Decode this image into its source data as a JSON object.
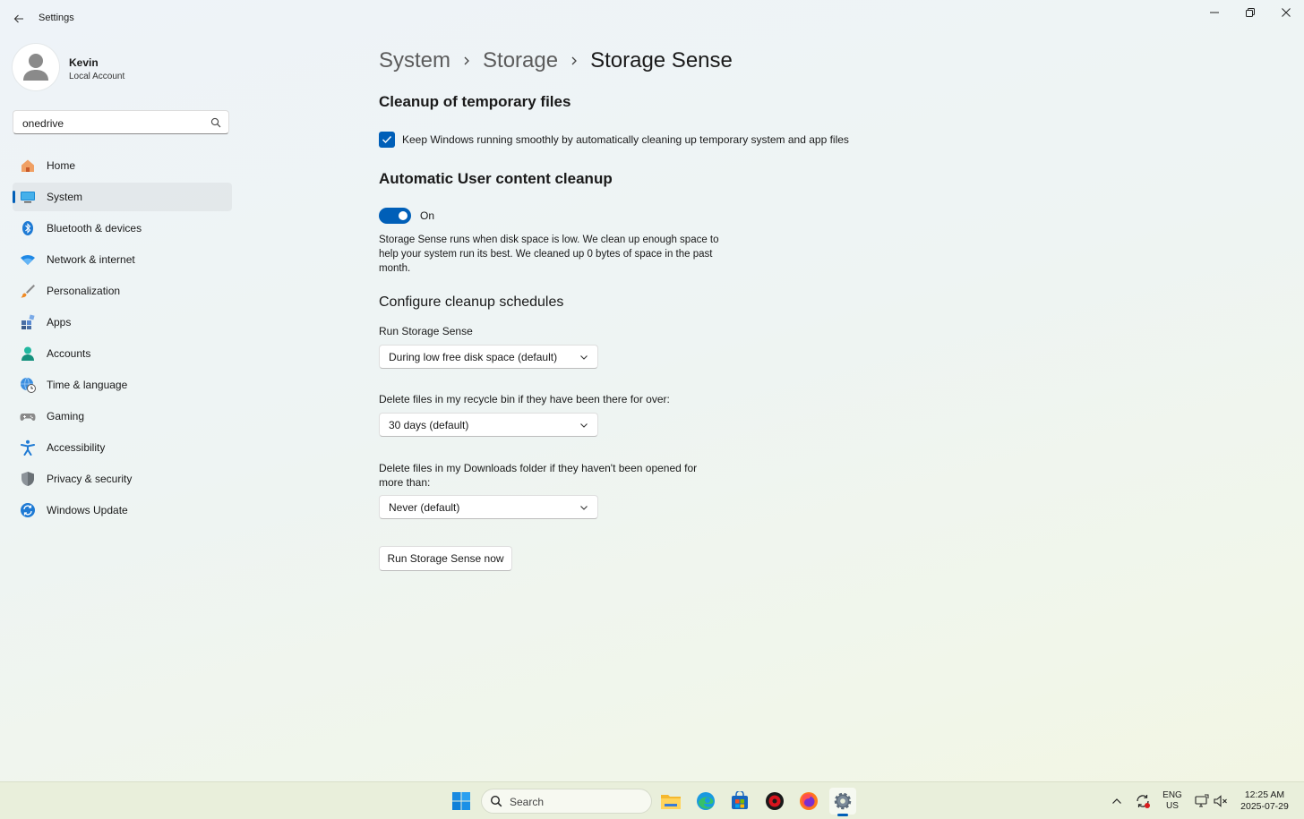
{
  "window": {
    "title": "Settings"
  },
  "profile": {
    "name": "Kevin",
    "account_type": "Local Account"
  },
  "search": {
    "value": "onedrive"
  },
  "sidebar": {
    "items": [
      {
        "label": "Home",
        "icon": "home-icon"
      },
      {
        "label": "System",
        "icon": "system-icon",
        "selected": true
      },
      {
        "label": "Bluetooth & devices",
        "icon": "bluetooth-icon"
      },
      {
        "label": "Network & internet",
        "icon": "wifi-icon"
      },
      {
        "label": "Personalization",
        "icon": "brush-icon"
      },
      {
        "label": "Apps",
        "icon": "apps-icon"
      },
      {
        "label": "Accounts",
        "icon": "accounts-icon"
      },
      {
        "label": "Time & language",
        "icon": "globe-clock-icon"
      },
      {
        "label": "Gaming",
        "icon": "gamepad-icon"
      },
      {
        "label": "Accessibility",
        "icon": "accessibility-icon"
      },
      {
        "label": "Privacy & security",
        "icon": "shield-icon"
      },
      {
        "label": "Windows Update",
        "icon": "update-icon"
      }
    ]
  },
  "breadcrumb": {
    "level1": "System",
    "level2": "Storage",
    "current": "Storage Sense"
  },
  "cleanup": {
    "heading": "Cleanup of temporary files",
    "checkbox_label": "Keep Windows running smoothly by automatically cleaning up temporary system and app files",
    "checked": true
  },
  "auto_cleanup": {
    "heading": "Automatic User content cleanup",
    "toggle_label": "On",
    "description": "Storage Sense runs when disk space is low. We clean up enough space to help your system run its best. We cleaned up 0 bytes of space in the past month."
  },
  "schedules": {
    "heading": "Configure cleanup schedules",
    "run_label": "Run Storage Sense",
    "run_value": "During low free disk space (default)",
    "recycle_label": "Delete files in my recycle bin if they have been there for over:",
    "recycle_value": "30 days (default)",
    "downloads_label": "Delete files in my Downloads folder if they haven't been opened for more than:",
    "downloads_value": "Never (default)",
    "run_now_label": "Run Storage Sense now"
  },
  "taskbar": {
    "search_placeholder": "Search",
    "lang_line1": "ENG",
    "lang_line2": "US",
    "time": "12:25 AM",
    "date": "2025-07-29"
  },
  "colors": {
    "accent": "#005fb8"
  }
}
